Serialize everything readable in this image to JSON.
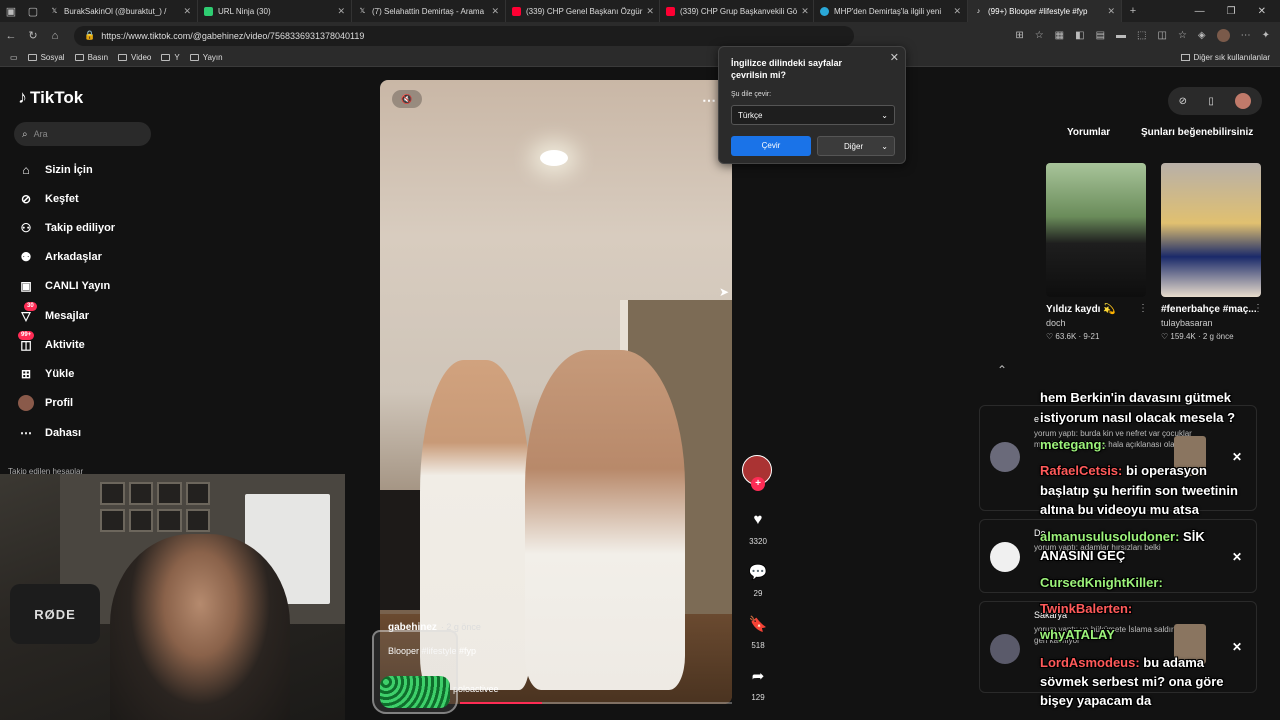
{
  "browser": {
    "tabs": [
      {
        "title": "BurakSakinOl (@buraktut_) /",
        "icon": "x-icon",
        "color": "#ffffff"
      },
      {
        "title": "URL Ninja (30)",
        "icon": "ninja-icon",
        "color": "#2ecc71"
      },
      {
        "title": "(7) Selahattin Demirtaş - Arama",
        "icon": "x-icon",
        "color": "#ffffff"
      },
      {
        "title": "(339) CHP Genel Başkanı Özgür",
        "icon": "youtube-icon",
        "color": "#ff0033"
      },
      {
        "title": "(339) CHP Grup Başkanvekili Gö",
        "icon": "youtube-icon",
        "color": "#ff0033"
      },
      {
        "title": "MHP'den Demirtaş'la ilgili yeni",
        "icon": "globe-icon",
        "color": "#2aa8d8"
      },
      {
        "title": "(99+) Blooper #lifestyle #fyp",
        "icon": "tiktok-icon",
        "color": "#ffffff"
      }
    ],
    "url": "https://www.tiktok.com/@gabehinez/video/7568336931378040119",
    "bookmarks": [
      "Sosyal",
      "Basın",
      "Video",
      "Y",
      "Yayın"
    ],
    "bookmarks_right": "Diğer sık kullanılanlar"
  },
  "translate_popup": {
    "title": "İngilizce dilindeki sayfalar çevrilsin mi?",
    "label": "Şu dile çevir:",
    "selected": "Türkçe",
    "primary_button": "Çevir",
    "secondary_button": "Diğer"
  },
  "tiktok": {
    "logo": "TikTok",
    "search_placeholder": "Ara",
    "menu": [
      {
        "label": "Sizin İçin",
        "icon": "home-icon"
      },
      {
        "label": "Keşfet",
        "icon": "compass-icon"
      },
      {
        "label": "Takip ediliyor",
        "icon": "following-icon"
      },
      {
        "label": "Arkadaşlar",
        "icon": "friends-icon"
      },
      {
        "label": "CANLI Yayın",
        "icon": "live-icon"
      },
      {
        "label": "Mesajlar",
        "icon": "message-icon",
        "badge": "30"
      },
      {
        "label": "Aktivite",
        "icon": "activity-icon",
        "badge": "99+"
      },
      {
        "label": "Yükle",
        "icon": "upload-icon"
      },
      {
        "label": "Profil",
        "icon": "profile-avatar"
      },
      {
        "label": "Dahası",
        "icon": "more-icon"
      }
    ],
    "followed_accounts": "Takip edilen hesaplar",
    "video": {
      "username": "gabehinez",
      "ago": "· 2 g önce",
      "caption": "Blooper #lifestyle #fyp",
      "music": "d - poloactivee",
      "progress": 0.3
    },
    "actions": {
      "likes": "3320",
      "comments": "29",
      "saves": "518",
      "shares": "129"
    },
    "right_tabs": [
      "Yorumlar",
      "Şunları beğenebilirsiniz"
    ],
    "recommendations": [
      {
        "title": "Yıldız kaydı 💫",
        "author": "doch",
        "meta": "♡ 63.6K · 9-21"
      },
      {
        "title": "#fenerbahçe #maç...",
        "author": "tulaybasaran",
        "meta": "♡ 159.4K · 2 g önce"
      }
    ]
  },
  "notifications": [
    {
      "user": "e",
      "text": "yorum yaptı: burda kin ve nefret var çocuklar müslüman toplumda hala açıklanası olamaz"
    },
    {
      "user": "De",
      "text": "yorum yaptı: adamlar hırsızları belki"
    },
    {
      "user": "Sakarya",
      "text": "yorum yaptı: ve hükümete İslama saldırmak geri kalmıyor"
    }
  ],
  "chat_overlay": [
    {
      "nick": "",
      "msg": "hem Berkin'in davasını gütmek"
    },
    {
      "nick": "",
      "msg": "istiyorum nasıl olacak mesela ?"
    },
    {
      "nick": "metegang:",
      "msg": ""
    },
    {
      "nick": "RafaelCetsis:",
      "msg": "bi operasyon"
    },
    {
      "nick": "",
      "msg": "başlatıp şu herifin son tweetinin"
    },
    {
      "nick": "",
      "msg": "altına bu videoyu mu atsa"
    },
    {
      "nick": "almanusulusoludoner:",
      "msg": "SİK"
    },
    {
      "nick": "",
      "msg": "ANASINI GEÇ"
    },
    {
      "nick": "CursedKnightKiller:",
      "msg": ""
    },
    {
      "nick": "TwinkBalerten:",
      "msg": ""
    },
    {
      "nick": "whyATALAY",
      "msg": ""
    },
    {
      "nick": "LordAsmodeus:",
      "msg": "bu adama"
    },
    {
      "nick": "",
      "msg": "sövmek serbest mi? ona göre"
    },
    {
      "nick": "",
      "msg": "bişey yapacam da"
    }
  ],
  "webcam": {
    "mic_label": "RØDE"
  }
}
